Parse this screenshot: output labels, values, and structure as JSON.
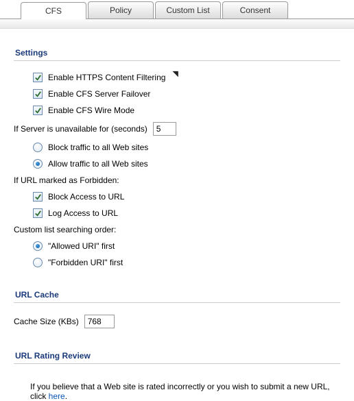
{
  "tabs": {
    "cfs": "CFS",
    "policy": "Policy",
    "custom_list": "Custom List",
    "consent": "Consent"
  },
  "sections": {
    "settings": "Settings",
    "url_cache": "URL Cache",
    "url_rating": "URL Rating Review"
  },
  "settings": {
    "https_filter": "Enable HTTPS Content Filtering",
    "cfs_failover": "Enable CFS Server Failover",
    "cfs_wire": "Enable CFS Wire Mode",
    "server_unavail_label": "If Server is unavailable for (seconds)",
    "server_unavail_value": "5",
    "block_all": "Block traffic to all Web sites",
    "allow_all": "Allow traffic to all Web sites",
    "url_forbidden_label": "If URL marked as Forbidden:",
    "block_url": "Block Access to URL",
    "log_url": "Log Access to URL",
    "custom_order_label": "Custom list searching order:",
    "allowed_first": "\"Allowed URI\" first",
    "forbidden_first": "\"Forbidden URI\" first"
  },
  "url_cache": {
    "size_label": "Cache Size (KBs)",
    "size_value": "768"
  },
  "rating": {
    "text": "If you believe that a Web site is rated incorrectly or you wish to submit a new URL, click ",
    "link": "here",
    "tail": "."
  }
}
